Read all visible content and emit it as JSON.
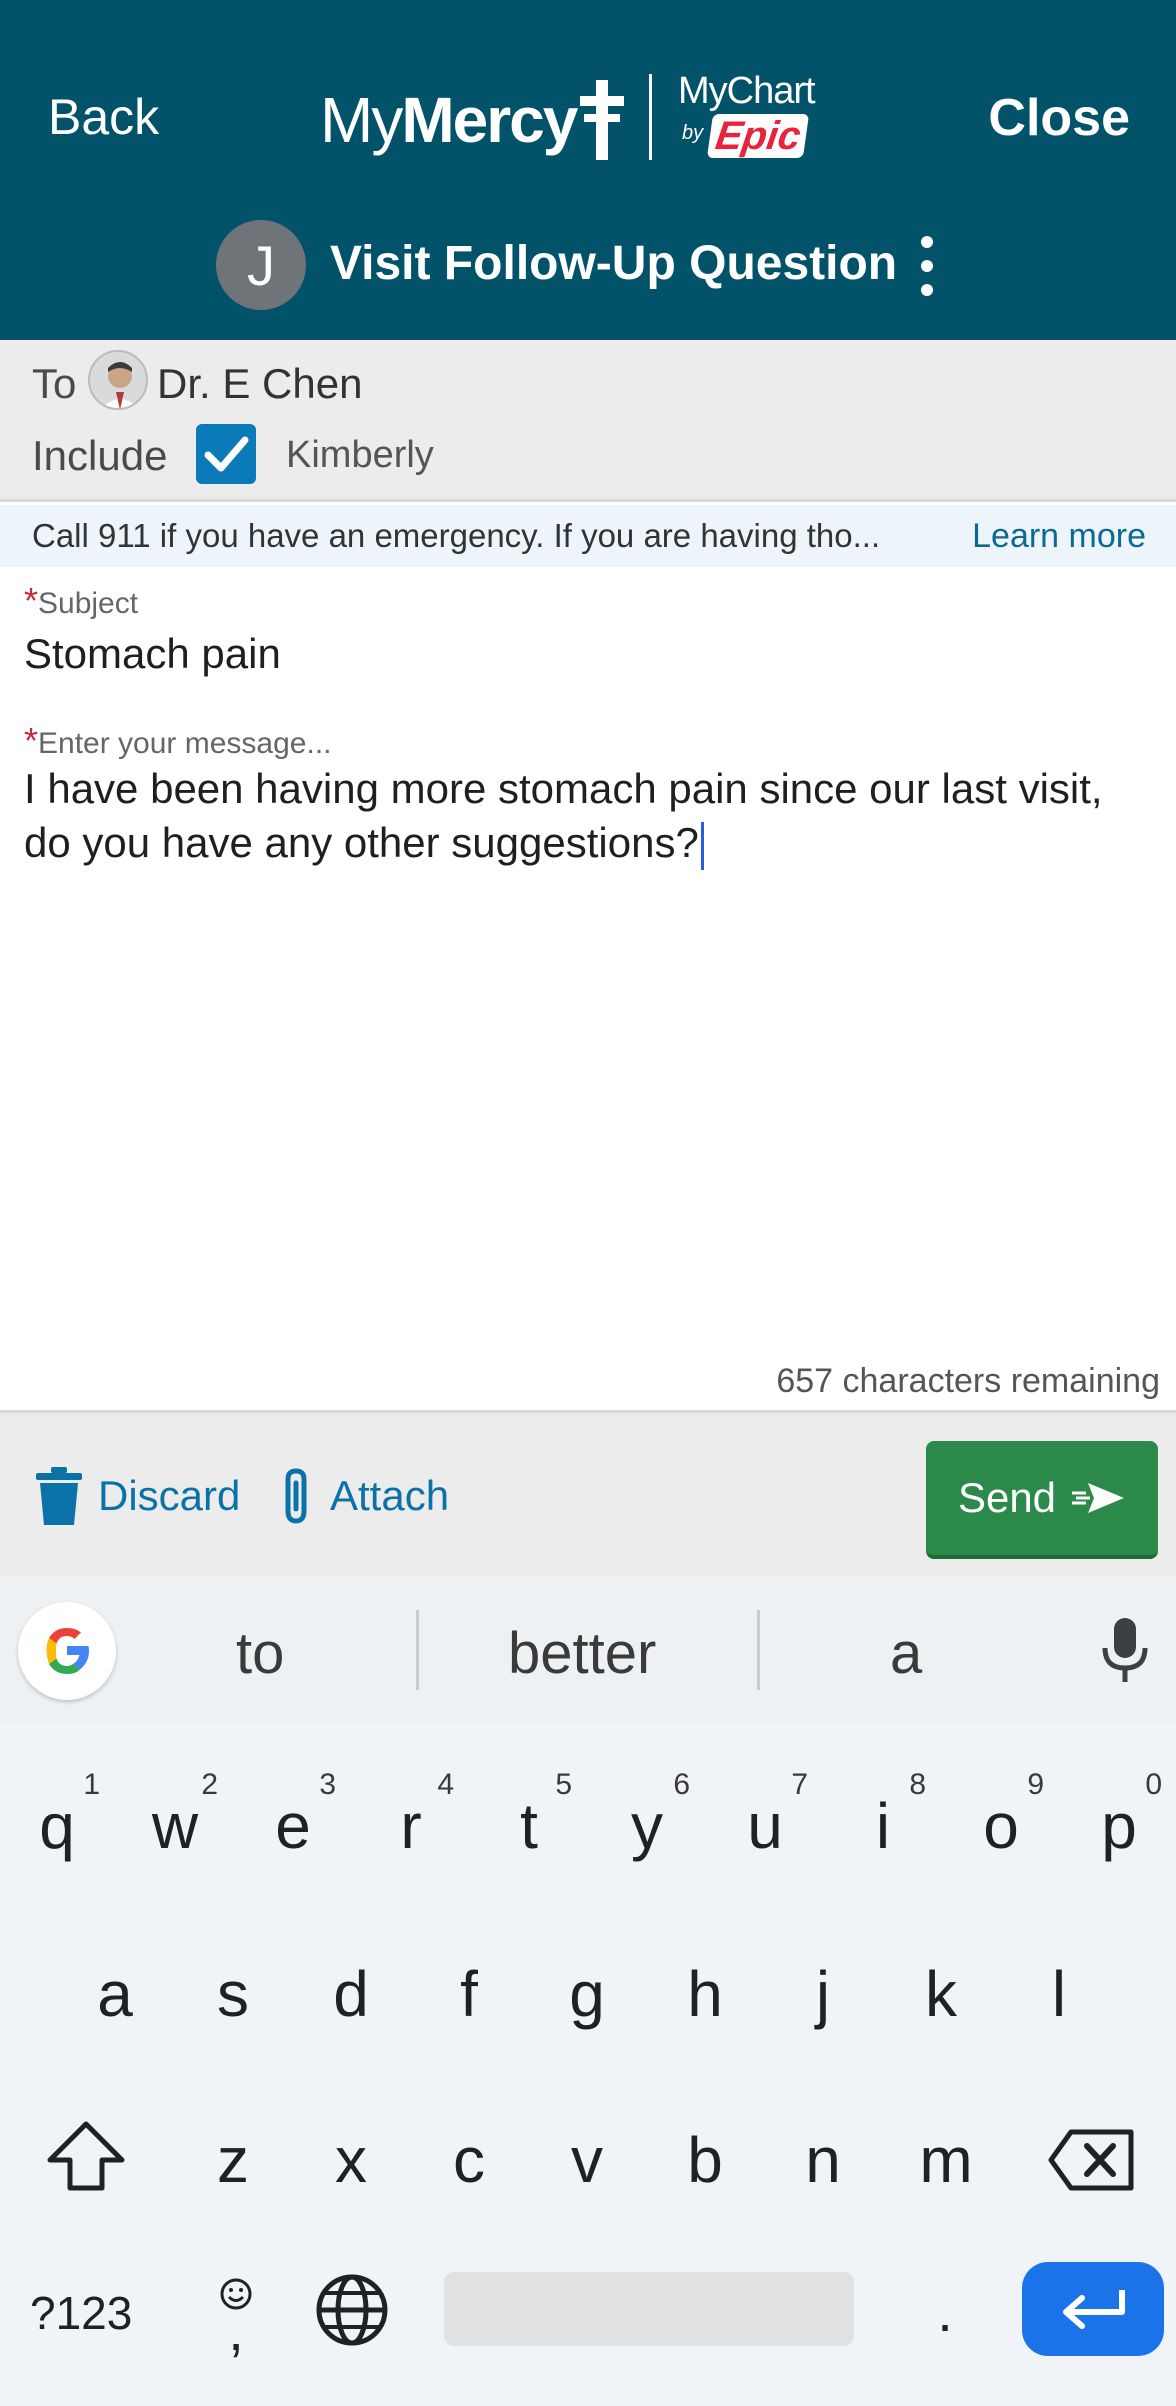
{
  "header": {
    "back_label": "Back",
    "close_label": "Close",
    "logo_left_prefix": "My",
    "logo_left_main": "Mercy",
    "logo_right_main": "MyChart",
    "logo_right_by": "by",
    "logo_right_brand": "Epic",
    "avatar_initial": "J",
    "title": "Visit Follow-Up Question"
  },
  "recipients": {
    "to_label": "To",
    "doctor_name": "Dr. E Chen",
    "include_label": "Include",
    "include_checked": true,
    "include_name": "Kimberly"
  },
  "banner": {
    "text": "Call 911 if you have an emergency. If you are having tho...",
    "link": "Learn more"
  },
  "form": {
    "required_mark": "*",
    "subject_label": "Subject",
    "subject_value": "Stomach pain",
    "message_placeholder": "Enter your message...",
    "message_value": "I have been having more stomach pain since our last visit, do you have any other suggestions?",
    "remaining_text": "657 characters remaining"
  },
  "actions": {
    "discard_label": "Discard",
    "attach_label": "Attach",
    "send_label": "Send"
  },
  "keyboard": {
    "suggestions": [
      "to",
      "better",
      "a"
    ],
    "row1": [
      "q",
      "w",
      "e",
      "r",
      "t",
      "y",
      "u",
      "i",
      "o",
      "p"
    ],
    "row1_numbers": [
      "1",
      "2",
      "3",
      "4",
      "5",
      "6",
      "7",
      "8",
      "9",
      "0"
    ],
    "row2": [
      "a",
      "s",
      "d",
      "f",
      "g",
      "h",
      "j",
      "k",
      "l"
    ],
    "row3": [
      "z",
      "x",
      "c",
      "v",
      "b",
      "n",
      "m"
    ],
    "symbols_label": "?123",
    "comma": ",",
    "period": ".",
    "enter_color": "#1a73e8"
  },
  "colors": {
    "header_bg": "#02536a",
    "send_bg": "#2b8a4a",
    "link": "#0b72a8",
    "required": "#c8283c"
  }
}
